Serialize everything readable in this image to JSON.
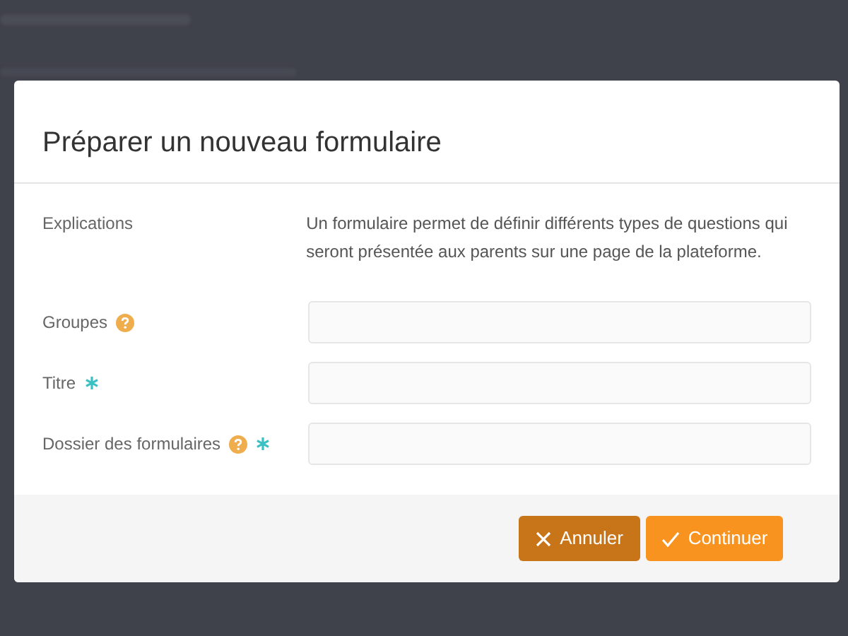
{
  "dialog": {
    "title": "Préparer un nouveau formulaire",
    "explanation": {
      "label": "Explications",
      "text": "Un formulaire permet de définir différents types de questions qui seront présentée aux parents sur une page de la plateforme."
    },
    "fields": [
      {
        "label": "Groupes",
        "help": true,
        "required": false
      },
      {
        "label": "Titre",
        "help": false,
        "required": true
      },
      {
        "label": "Dossier des formulaires",
        "help": true,
        "required": true
      }
    ],
    "buttons": [
      {
        "label": "Annuler",
        "kind": "cancel"
      },
      {
        "label": "Continuer",
        "kind": "confirm"
      }
    ]
  }
}
